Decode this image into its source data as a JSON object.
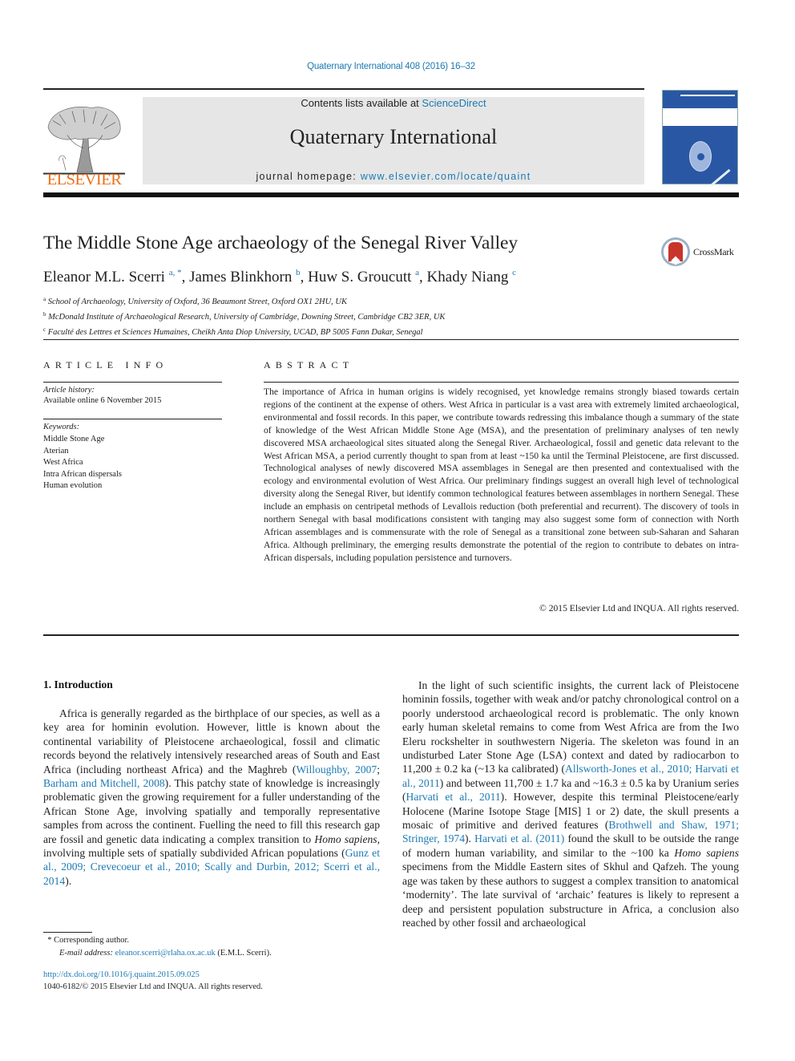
{
  "header": {
    "journal_ref": "Quaternary International 408 (2016) 16–32",
    "contents_prefix": "Contents lists available at ",
    "contents_link": "ScienceDirect",
    "journal_name": "Quaternary International",
    "homepage_prefix": "journal homepage: ",
    "homepage_link": "www.elsevier.com/locate/quaint",
    "publisher_logo_text": "ELSEVIER",
    "publisher_logo_icon": "tree-logo-icon",
    "cover_icon": "journal-cover-icon"
  },
  "article": {
    "title": "The Middle Stone Age archaeology of the Senegal River Valley",
    "crossmark_label": "CrossMark",
    "authors": [
      {
        "name": "Eleanor M.L. Scerri",
        "sup": "a, *"
      },
      {
        "name": "James Blinkhorn",
        "sup": "b"
      },
      {
        "name": "Huw S. Groucutt",
        "sup": "a"
      },
      {
        "name": "Khady Niang",
        "sup": "c"
      }
    ],
    "affiliations": [
      {
        "sup": "a",
        "text": "School of Archaeology, University of Oxford, 36 Beaumont Street, Oxford OX1 2HU, UK"
      },
      {
        "sup": "b",
        "text": "McDonald Institute of Archaeological Research, University of Cambridge, Downing Street, Cambridge CB2 3ER, UK"
      },
      {
        "sup": "c",
        "text": "Faculté des Lettres et Sciences Humaines, Cheikh Anta Diop University, UCAD, BP 5005 Fann Dakar, Senegal"
      }
    ]
  },
  "article_info": {
    "heading": "ARTICLE INFO",
    "history_label": "Article history:",
    "history_value": "Available online 6 November 2015",
    "keywords_label": "Keywords:",
    "keywords": [
      "Middle Stone Age",
      "Aterian",
      "West Africa",
      "Intra African dispersals",
      "Human evolution"
    ]
  },
  "abstract": {
    "heading": "ABSTRACT",
    "text": "The importance of Africa in human origins is widely recognised, yet knowledge remains strongly biased towards certain regions of the continent at the expense of others. West Africa in particular is a vast area with extremely limited archaeological, environmental and fossil records. In this paper, we contribute towards redressing this imbalance though a summary of the state of knowledge of the West African Middle Stone Age (MSA), and the presentation of preliminary analyses of ten newly discovered MSA archaeological sites situated along the Senegal River. Archaeological, fossil and genetic data relevant to the West African MSA, a period currently thought to span from at least ~150 ka until the Terminal Pleistocene, are first discussed. Technological analyses of newly discovered MSA assemblages in Senegal are then presented and contextualised with the ecology and environmental evolution of West Africa. Our preliminary findings suggest an overall high level of technological diversity along the Senegal River, but identify common technological features between assemblages in northern Senegal. These include an emphasis on centripetal methods of Levallois reduction (both preferential and recurrent). The discovery of tools in northern Senegal with basal modifications consistent with tanging may also suggest some form of connection with North African assemblages and is commensurate with the role of Senegal as a transitional zone between sub-Saharan and Saharan Africa. Although preliminary, the emerging results demonstrate the potential of the region to contribute to debates on intra-African dispersals, including population persistence and turnovers.",
    "copyright": "© 2015 Elsevier Ltd and INQUA. All rights reserved."
  },
  "body": {
    "section_heading": "1.  Introduction",
    "left_para": [
      {
        "t": "Africa is generally regarded as the birthplace of our species, as well as a key area for hominin evolution. However, little is known about the continental variability of Pleistocene archaeological, fossil and climatic records beyond the relatively intensively researched areas of South and East Africa (including northeast Africa) and the Maghreb ("
      },
      {
        "link": "Willoughby, 2007"
      },
      {
        "t": "; "
      },
      {
        "link": "Barham and Mitchell, 2008"
      },
      {
        "t": "). This patchy state of knowledge is increasingly problematic given the growing requirement for a fuller understanding of the African Stone Age, involving spatially and temporally representative samples from across the continent. Fuelling the need to fill this research gap are fossil and genetic data indicating a complex transition to "
      },
      {
        "em": "Homo sapiens"
      },
      {
        "t": ", involving multiple sets of spatially subdivided African populations ("
      },
      {
        "link": "Gunz et al., 2009; Crevecoeur et al., 2010; Scally and Durbin, 2012; Scerri et al., 2014"
      },
      {
        "t": ")."
      }
    ],
    "right_para": [
      {
        "t": "In the light of such scientific insights, the current lack of Pleistocene hominin fossils, together with weak and/or patchy chronological control on a poorly understood archaeological record is problematic. The only known early human skeletal remains to come from West Africa are from the Iwo Eleru rockshelter in southwestern Nigeria. The skeleton was found in an undisturbed Later Stone Age (LSA) context and dated by radiocarbon to 11,200 ± 0.2 ka (~13 ka calibrated) ("
      },
      {
        "link": "Allsworth-Jones et al., 2010; Harvati et al., 2011"
      },
      {
        "t": ") and between 11,700 ± 1.7 ka and ~16.3 ± 0.5 ka by Uranium series ("
      },
      {
        "link": "Harvati et al., 2011"
      },
      {
        "t": "). However, despite this terminal Pleistocene/early Holocene (Marine Isotope Stage [MIS] 1 or 2) date, the skull presents a mosaic of primitive and derived features ("
      },
      {
        "link": "Brothwell and Shaw, 1971; Stringer, 1974"
      },
      {
        "t": "). "
      },
      {
        "link": "Harvati et al. (2011)"
      },
      {
        "t": " found the skull to be outside the range of modern human variability, and similar to the ~100 ka "
      },
      {
        "em": "Homo sapiens"
      },
      {
        "t": " specimens from the Middle Eastern sites of Skhul and Qafzeh. The young age was taken by these authors to suggest a complex transition to anatomical ‘modernity’. The late survival of ‘archaic’ features is likely to represent a deep and persistent population substructure in Africa, a conclusion also reached by other fossil and archaeological"
      }
    ]
  },
  "footnotes": {
    "corresponding_marker": "*",
    "corresponding_text": "Corresponding author.",
    "email_label": "E-mail address:",
    "email": "eleanor.scerri@rlaha.ox.ac.uk",
    "email_suffix": " (E.M.L. Scerri).",
    "doi": "http://dx.doi.org/10.1016/j.quaint.2015.09.025",
    "issn_line": "1040-6182/© 2015 Elsevier Ltd and INQUA. All rights reserved."
  }
}
